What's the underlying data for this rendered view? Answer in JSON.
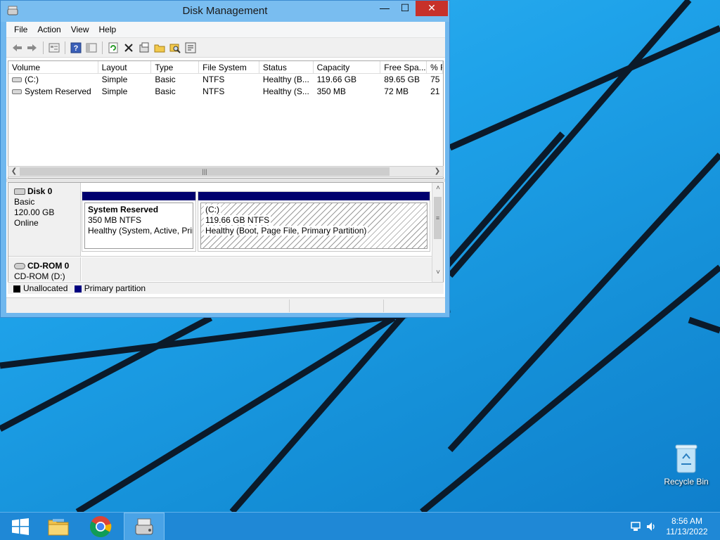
{
  "window": {
    "title": "Disk Management",
    "min_glyph": "—",
    "max_glyph": "☐",
    "close_glyph": "✕"
  },
  "menu": [
    "File",
    "Action",
    "View",
    "Help"
  ],
  "toolbar": {
    "icons": [
      "back-arrow-icon",
      "forward-arrow-icon",
      "properties-icon",
      "help-icon",
      "show-hide-icon",
      "refresh-icon",
      "delete-icon",
      "disk-properties-icon",
      "open-folder-icon",
      "explore-icon",
      "rescan-icon"
    ]
  },
  "list": {
    "columns": [
      "Volume",
      "Layout",
      "Type",
      "File System",
      "Status",
      "Capacity",
      "Free Spa...",
      "% F"
    ],
    "rows": [
      [
        "(C:)",
        "Simple",
        "Basic",
        "NTFS",
        "Healthy (B...",
        "119.66 GB",
        "89.65 GB",
        "75"
      ],
      [
        "System Reserved",
        "Simple",
        "Basic",
        "NTFS",
        "Healthy (S...",
        "350 MB",
        "72 MB",
        "21"
      ]
    ]
  },
  "disks": [
    {
      "name": "Disk 0",
      "type": "Basic",
      "size": "120.00 GB",
      "status": "Online",
      "partitions": [
        {
          "name": "System Reserved",
          "size": "350 MB NTFS",
          "status": "Healthy (System, Active, Prir"
        },
        {
          "name": "(C:)",
          "size": "119.66 GB NTFS",
          "status": "Healthy (Boot, Page File, Primary Partition)"
        }
      ]
    },
    {
      "name": "CD-ROM 0",
      "type": "CD-ROM (D:)"
    }
  ],
  "legend": [
    {
      "label": "Unallocated",
      "color": "#000000"
    },
    {
      "label": "Primary partition",
      "color": "#00007f"
    }
  ],
  "desktop": {
    "recycle_bin_label": "Recycle Bin"
  },
  "taskbar": {
    "items": [
      "start-button",
      "file-explorer",
      "chrome",
      "disk-management"
    ],
    "time": "8:56 AM",
    "date": "11/13/2022"
  }
}
